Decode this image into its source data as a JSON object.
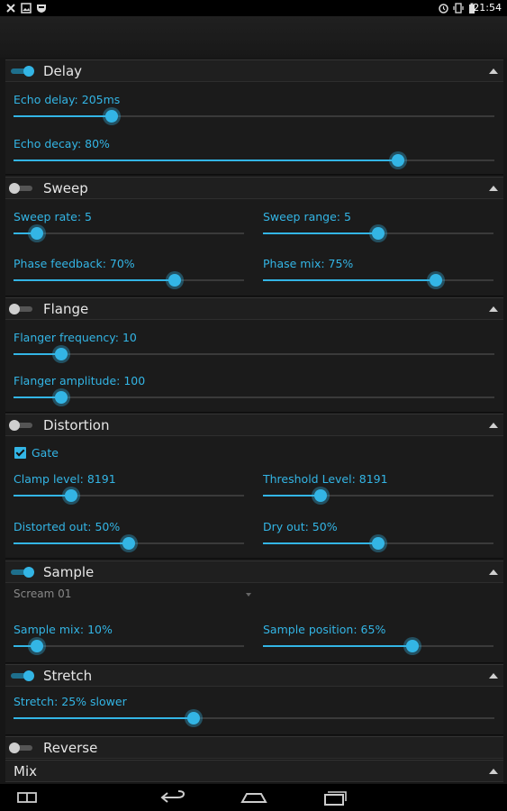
{
  "status_bar": {
    "time": "21:54",
    "left_icons": [
      "tools-icon",
      "image-icon",
      "shield-icon"
    ],
    "right_icons": [
      "alarm-icon",
      "vibrate-icon",
      "battery-icon"
    ]
  },
  "colors": {
    "accent": "#33b5e5",
    "background": "#161616",
    "panel": "#1b1b1b",
    "text": "#e6e6e6"
  },
  "panels": {
    "delay": {
      "title": "Delay",
      "enabled": true,
      "sliders": [
        {
          "label": "Echo delay: 205ms",
          "fraction": 0.205
        },
        {
          "label": "Echo decay: 80%",
          "fraction": 0.8
        }
      ]
    },
    "sweep": {
      "title": "Sweep",
      "enabled": false,
      "sliders": [
        {
          "label": "Sweep rate: 5",
          "fraction": 0.1
        },
        {
          "label": "Sweep range: 5",
          "fraction": 0.5
        },
        {
          "label": "Phase feedback: 70%",
          "fraction": 0.7
        },
        {
          "label": "Phase mix: 75%",
          "fraction": 0.75
        }
      ]
    },
    "flange": {
      "title": "Flange",
      "enabled": false,
      "sliders": [
        {
          "label": "Flanger frequency: 10",
          "fraction": 0.1
        },
        {
          "label": "Flanger amplitude: 100",
          "fraction": 0.1
        }
      ]
    },
    "distortion": {
      "title": "Distortion",
      "enabled": false,
      "gate_label": "Gate",
      "gate_checked": true,
      "sliders": [
        {
          "label": "Clamp level: 8191",
          "fraction": 0.25
        },
        {
          "label": "Threshold Level: 8191",
          "fraction": 0.25
        },
        {
          "label": "Distorted out: 50%",
          "fraction": 0.5
        },
        {
          "label": "Dry out: 50%",
          "fraction": 0.5
        }
      ]
    },
    "sample": {
      "title": "Sample",
      "enabled": true,
      "selected_sample": "Scream 01",
      "sliders": [
        {
          "label": "Sample mix: 10%",
          "fraction": 0.1
        },
        {
          "label": "Sample position: 65%",
          "fraction": 0.65
        }
      ]
    },
    "stretch": {
      "title": "Stretch",
      "enabled": true,
      "sliders": [
        {
          "label": "Stretch: 25% slower",
          "fraction": 0.375
        }
      ]
    },
    "reverse": {
      "title": "Reverse",
      "enabled": false
    },
    "mix": {
      "title": "Mix"
    }
  },
  "nav_bar": {
    "buttons": [
      "split-screen-icon",
      "back-icon",
      "home-icon",
      "recents-icon"
    ]
  }
}
